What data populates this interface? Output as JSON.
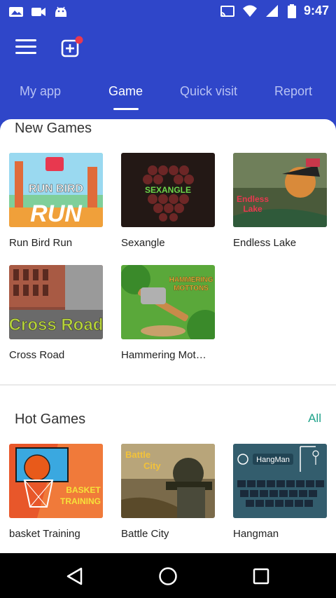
{
  "status_bar": {
    "time": "9:47",
    "left_icons": [
      "photo-icon",
      "video-icon",
      "android-icon"
    ],
    "right_icons": [
      "cast-icon",
      "wifi-icon",
      "signal-icon",
      "battery-icon"
    ]
  },
  "app_bar": {
    "icons": [
      "menu-icon",
      "add-notification-icon"
    ],
    "notification_dot_color": "#e8384f"
  },
  "tabs": [
    {
      "label": "My app",
      "active": false
    },
    {
      "label": "Game",
      "active": true
    },
    {
      "label": "Quick visit",
      "active": false
    },
    {
      "label": "Report",
      "active": false
    }
  ],
  "new_games": {
    "title": "New Games",
    "items": [
      {
        "name": "Run Bird Run",
        "thumb_text": "RUN BIRD RUN"
      },
      {
        "name": "Sexangle",
        "thumb_text": "SEXANGLE"
      },
      {
        "name": "Endless Lake",
        "thumb_text": "Endless Lake"
      },
      {
        "name": "Cross Road",
        "thumb_text": "Cross Road"
      },
      {
        "name": "Hammering Mot…",
        "thumb_text": "HAMMERING MOTTONS"
      }
    ]
  },
  "hot_games": {
    "title": "Hot Games",
    "all_label": "All",
    "all_color": "#1fa38a",
    "items": [
      {
        "name": "basket Training",
        "thumb_text": "BASKET TRAINING"
      },
      {
        "name": "Battle City",
        "thumb_text": "Battle City"
      },
      {
        "name": "Hangman",
        "thumb_text": "HangMan"
      }
    ]
  },
  "nav_bar": {
    "buttons": [
      "back-icon",
      "home-icon",
      "recents-icon"
    ]
  },
  "colors": {
    "primary": "#2f46c9",
    "tab_inactive": "#b8c2f3",
    "accent": "#1fa38a"
  }
}
